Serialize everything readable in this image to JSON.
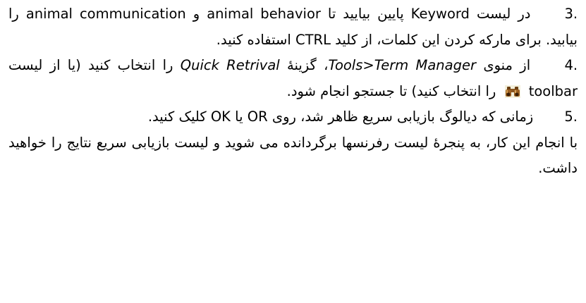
{
  "steps": [
    {
      "number": "3.",
      "t1": "در لیست",
      "t2": "Keyword",
      "t3": "پایین بیایید تا",
      "t4": "animal behavior",
      "t5": "و",
      "t6": "animal communication",
      "t7": "را بیابید. برای مارکه کردن این کلمات، از کلید",
      "t8": "CTRL",
      "t9": "استفاده کنید."
    },
    {
      "number": "4.",
      "t1": "از منوی",
      "t2": "Tools>Term Manager",
      "t3": "، گزینۀ",
      "t4": "Quick Retrival",
      "t5": "را انتخاب کنید (یا از لیست",
      "t6": "toolbar",
      "icon": "binoculars-icon",
      "t7": "را انتخاب کنید) تا جستجو انجام شود."
    },
    {
      "number": "5.",
      "t1": "زمانی که دیالوگ بازیابی سریع ظاهر شد، روی",
      "t2": "OR",
      "t3": "یا",
      "t4": "OK",
      "t5": "کلیک کنید."
    }
  ],
  "closing": "با انجام این کار، به پنجرۀ لیست رفرنسها برگردانده می شوید و لیست بازیابی سریع نتایج را خواهید داشت."
}
